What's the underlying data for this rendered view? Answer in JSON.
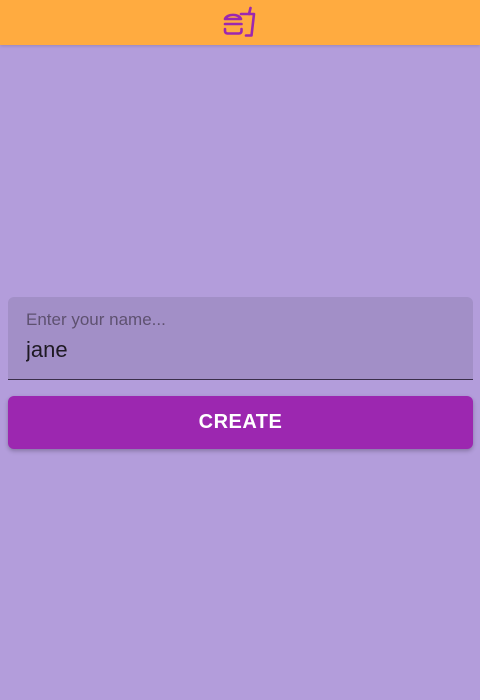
{
  "app_bar": {
    "icon": "fastfood-icon",
    "background_color": "#ffab40",
    "icon_color": "#9c27b0"
  },
  "form": {
    "name_field": {
      "label": "Enter your name...",
      "value": "jane"
    },
    "create_button": {
      "label": "CREATE",
      "color": "#9c27b0"
    }
  },
  "page": {
    "background_color": "#b39ddb"
  }
}
